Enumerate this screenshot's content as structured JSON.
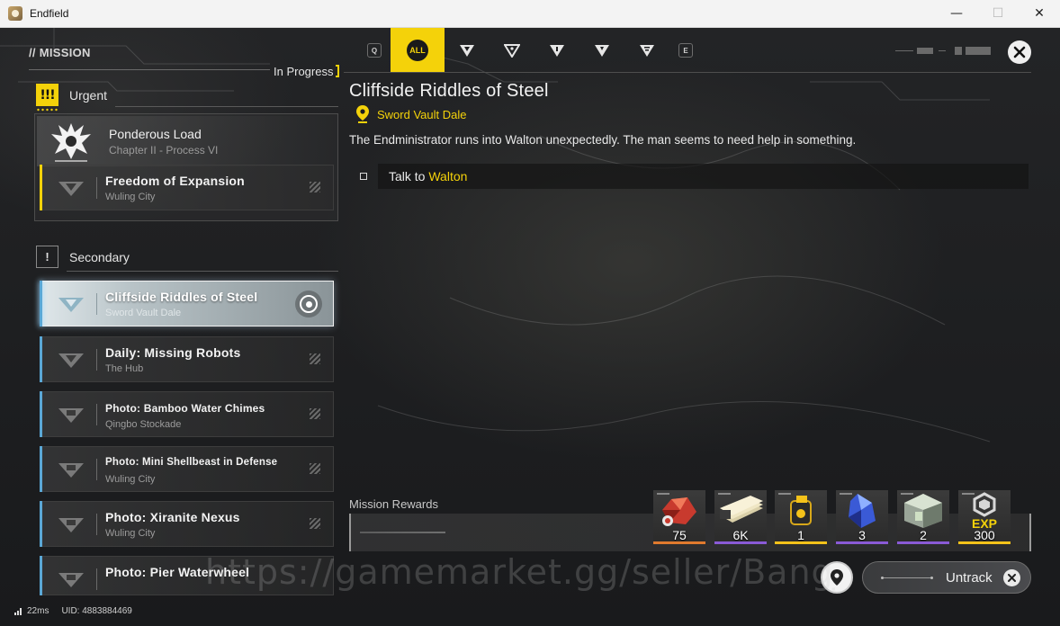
{
  "window": {
    "title": "Endfield",
    "minimize_glyph": "—",
    "maximize_glyph": "☐",
    "close_glyph": "✕"
  },
  "left_panel": {
    "header": "// MISSION",
    "in_progress_label": "In Progress",
    "urgent": {
      "icon_text": "!!!",
      "label": "Urgent",
      "chapter": {
        "title": "Ponderous Load",
        "subtitle": "Chapter II - Process VI"
      },
      "quests": [
        {
          "title": "Freedom of Expansion",
          "location": "Wuling City"
        }
      ]
    },
    "secondary": {
      "icon_text": "!",
      "label": "Secondary",
      "quests": [
        {
          "title": "Cliffside Riddles of Steel",
          "location": "Sword Vault Dale",
          "selected": true
        },
        {
          "title": "Daily: Missing Robots",
          "location": "The Hub"
        },
        {
          "title": "Photo: Bamboo Water Chimes",
          "location": "Qingbo Stockade"
        },
        {
          "title": "Photo: Mini Shellbeast in Defense",
          "location": "Wuling City"
        },
        {
          "title": "Photo: Xiranite Nexus",
          "location": "Wuling City"
        },
        {
          "title": "Photo: Pier Waterwheel",
          "location": ""
        }
      ]
    }
  },
  "tabs": {
    "left_key": "Q",
    "right_key": "E",
    "items": [
      {
        "name": "all",
        "label": "ALL",
        "active": true
      },
      {
        "name": "main",
        "label": ""
      },
      {
        "name": "side",
        "label": ""
      },
      {
        "name": "event",
        "label": ""
      },
      {
        "name": "daily",
        "label": ""
      },
      {
        "name": "other",
        "label": ""
      }
    ]
  },
  "detail": {
    "title": "Cliffside Riddles of Steel",
    "location": "Sword Vault Dale",
    "description": "The Endministrator runs into Walton unexpectedly. The man seems to need help in something.",
    "objective_prefix": "Talk to ",
    "objective_target": "Walton"
  },
  "rewards": {
    "label": "Mission Rewards",
    "items": [
      {
        "name": "red-crystal",
        "qty": "75",
        "rarity_color": "#e07a2e"
      },
      {
        "name": "cash-bundle",
        "qty": "6K",
        "rarity_color": "#8a5ad6"
      },
      {
        "name": "battery",
        "qty": "1",
        "rarity_color": "#f4c21a"
      },
      {
        "name": "blue-crystal",
        "qty": "3",
        "rarity_color": "#8a5ad6"
      },
      {
        "name": "supply-crate",
        "qty": "2",
        "rarity_color": "#8a5ad6"
      },
      {
        "name": "exp",
        "label": "EXP",
        "qty": "300",
        "rarity_color": "#f4c21a"
      }
    ]
  },
  "untrack": {
    "label": "Untrack"
  },
  "footer": {
    "ping": "22ms",
    "uid": "UID: 4883884469"
  },
  "watermark": "https://gamemarket.gg/seller/BangJo",
  "colors": {
    "accent": "#f4d20a",
    "secondary_accent": "#5ba8d6"
  }
}
